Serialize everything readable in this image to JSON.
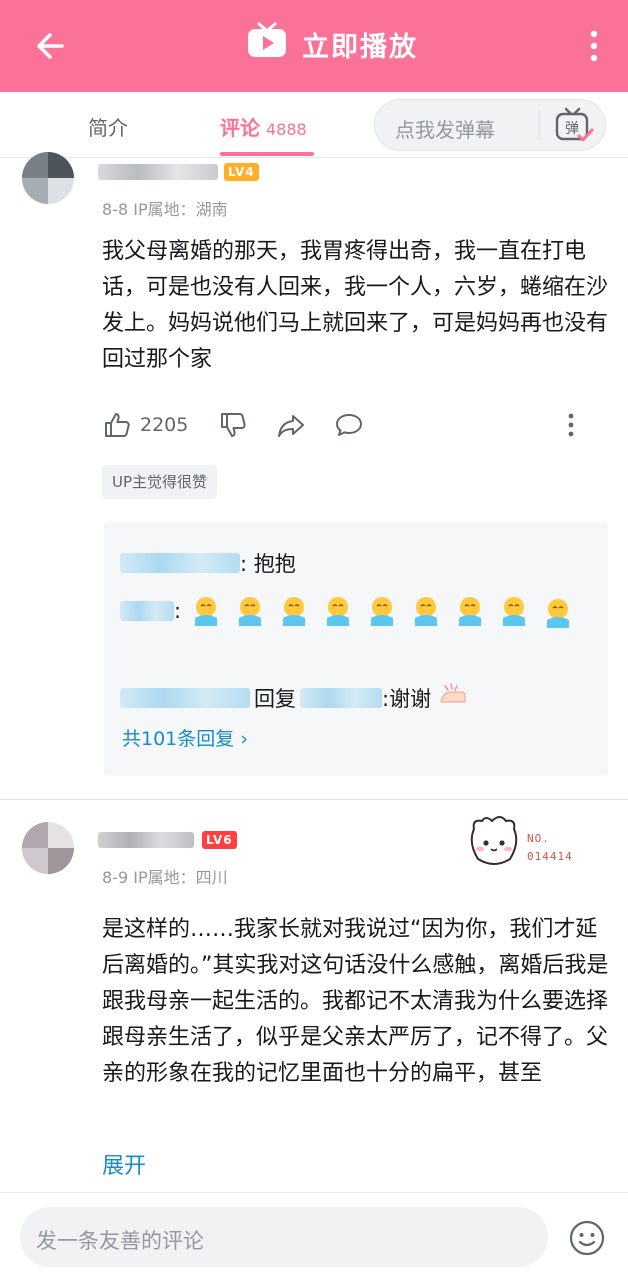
{
  "header": {
    "title": "立即播放",
    "back_icon": "back-arrow-icon",
    "tv_icon": "tv-play-icon",
    "more_icon": "more-vertical-icon",
    "bg_color": "#fb7299"
  },
  "tabs": {
    "intro_label": "简介",
    "comments_label": "评论",
    "comments_count": "4888",
    "danmaku_placeholder": "点我发弹幕",
    "danmaku_icon": "danmaku-toggle-icon"
  },
  "comments": [
    {
      "level": "LV4",
      "date": "8-8",
      "ip": "IP属地：湖南",
      "text": "我父母离婚的那天，我胃疼得出奇，我一直在打电话，可是也没有人回来，我一个人，六岁，蜷缩在沙发上。妈妈说他们马上就回来了，可是妈妈再也没有回过那个家",
      "likes": "2205",
      "up_badge": "UP主觉得很赞",
      "replies": [
        {
          "text": ": 抱抱"
        },
        {
          "text": ":"
        },
        {
          "reply_word": "回复",
          "text": ":谢谢"
        }
      ],
      "reply_more": "共101条回复"
    },
    {
      "level": "LV6",
      "date": "8-9",
      "ip": "IP属地：四川",
      "no_label": "NO.",
      "no_number": "014414",
      "text": "是这样的……我家长就对我说过“因为你，我们才延后离婚的。”其实我对这句话没什么感触，离婚后我是跟我母亲一起生活的。我都记不太清我为什么要选择跟母亲生活了，似乎是父亲太严厉了，记不得了。父亲的形象在我的记忆里面也十分的扁平，甚至",
      "expand": "展开"
    }
  ],
  "bottom": {
    "placeholder": "发一条友善的评论",
    "emoji_icon": "emoji-face-icon"
  },
  "colors": {
    "accent": "#fb7299",
    "link": "#178bcf",
    "lv4": "#ffb027",
    "lv6": "#ff3f3f"
  }
}
